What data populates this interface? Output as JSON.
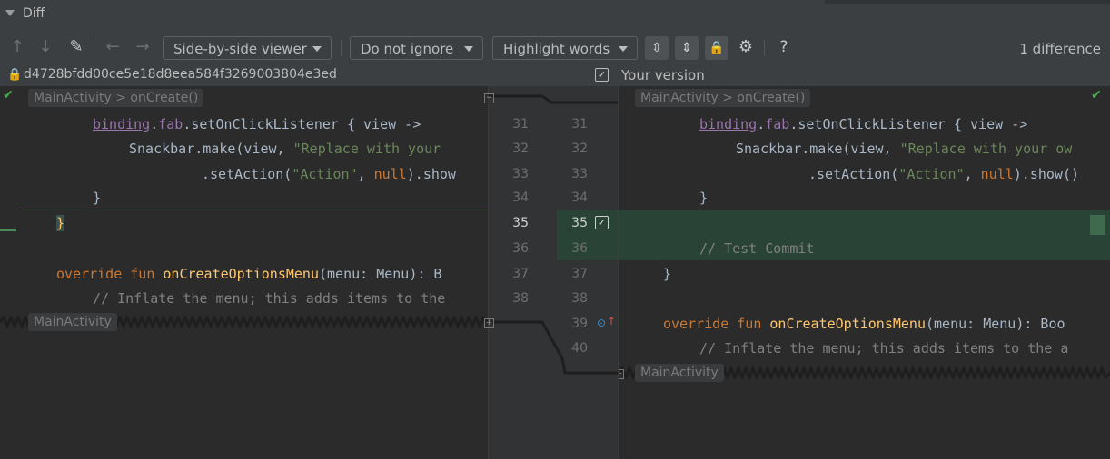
{
  "panel": {
    "title": "Diff"
  },
  "toolbar": {
    "viewer": "Side-by-side viewer",
    "ignore": "Do not ignore",
    "highlight": "Highlight words",
    "help": "?",
    "difference_count": "1 difference"
  },
  "header": {
    "left_revision": "d4728bfdd00ce5e18d8eea584f3269003804e3ed",
    "right_title": "Your version",
    "right_checked": true
  },
  "left": {
    "breadcrumb_top": "MainActivity > onCreate()",
    "breadcrumb_bottom": "MainActivity"
  },
  "right": {
    "breadcrumb_top": "MainActivity > onCreate()",
    "breadcrumb_bottom": "MainActivity"
  },
  "gutter": {
    "left_numbers": [
      "31",
      "32",
      "33",
      "34",
      "35",
      "36",
      "37",
      "38"
    ],
    "right_numbers": [
      "31",
      "32",
      "33",
      "34",
      "35",
      "36",
      "37",
      "38",
      "39",
      "40"
    ]
  },
  "code": {
    "left": [
      [
        "binding",
        ".",
        "fab",
        ".setOnClickListener { view ->"
      ],
      [
        "Snackbar.make(view, ",
        "\"Replace with your"
      ],
      [
        ".setAction(",
        "\"Action\"",
        ", ",
        "null",
        ").show"
      ],
      [
        "}"
      ],
      [
        "}"
      ],
      [
        ""
      ],
      [
        "override ",
        "fun ",
        "onCreateOptionsMenu",
        "(menu: Menu): B"
      ],
      [
        "// Inflate the menu; this adds items to the"
      ]
    ],
    "right": [
      [
        "binding",
        ".",
        "fab",
        ".setOnClickListener { view ->"
      ],
      [
        "Snackbar.make(view, ",
        "\"Replace with your ow"
      ],
      [
        ".setAction(",
        "\"Action\"",
        ", ",
        "null",
        ").show()"
      ],
      [
        "}"
      ],
      [
        ""
      ],
      [
        "// Test Commit"
      ],
      [
        "}"
      ],
      [
        ""
      ],
      [
        "override ",
        "fun ",
        "onCreateOptionsMenu",
        "(menu: Menu): Boo"
      ],
      [
        "// Inflate the menu; this adds items to the a"
      ]
    ]
  },
  "colors": {
    "insert_bg": "#294436",
    "keyword": "#cc7832",
    "function": "#ffc66d",
    "string": "#6a8759",
    "property": "#9876aa",
    "comment": "#808080"
  }
}
